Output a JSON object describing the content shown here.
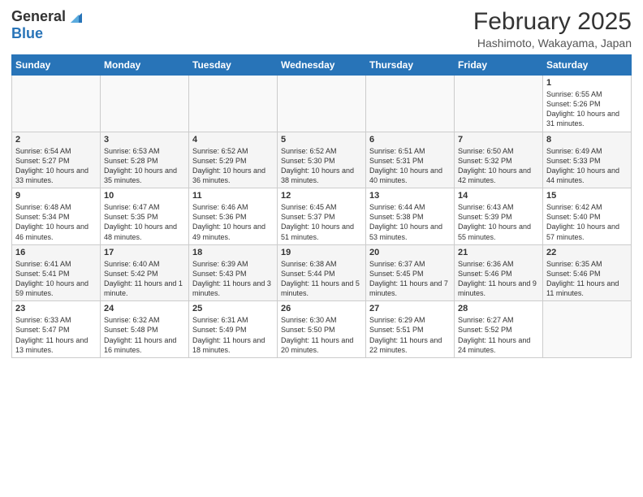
{
  "header": {
    "logo_general": "General",
    "logo_blue": "Blue",
    "month_title": "February 2025",
    "location": "Hashimoto, Wakayama, Japan"
  },
  "weekdays": [
    "Sunday",
    "Monday",
    "Tuesday",
    "Wednesday",
    "Thursday",
    "Friday",
    "Saturday"
  ],
  "weeks": [
    [
      {
        "day": "",
        "info": ""
      },
      {
        "day": "",
        "info": ""
      },
      {
        "day": "",
        "info": ""
      },
      {
        "day": "",
        "info": ""
      },
      {
        "day": "",
        "info": ""
      },
      {
        "day": "",
        "info": ""
      },
      {
        "day": "1",
        "info": "Sunrise: 6:55 AM\nSunset: 5:26 PM\nDaylight: 10 hours and 31 minutes."
      }
    ],
    [
      {
        "day": "2",
        "info": "Sunrise: 6:54 AM\nSunset: 5:27 PM\nDaylight: 10 hours and 33 minutes."
      },
      {
        "day": "3",
        "info": "Sunrise: 6:53 AM\nSunset: 5:28 PM\nDaylight: 10 hours and 35 minutes."
      },
      {
        "day": "4",
        "info": "Sunrise: 6:52 AM\nSunset: 5:29 PM\nDaylight: 10 hours and 36 minutes."
      },
      {
        "day": "5",
        "info": "Sunrise: 6:52 AM\nSunset: 5:30 PM\nDaylight: 10 hours and 38 minutes."
      },
      {
        "day": "6",
        "info": "Sunrise: 6:51 AM\nSunset: 5:31 PM\nDaylight: 10 hours and 40 minutes."
      },
      {
        "day": "7",
        "info": "Sunrise: 6:50 AM\nSunset: 5:32 PM\nDaylight: 10 hours and 42 minutes."
      },
      {
        "day": "8",
        "info": "Sunrise: 6:49 AM\nSunset: 5:33 PM\nDaylight: 10 hours and 44 minutes."
      }
    ],
    [
      {
        "day": "9",
        "info": "Sunrise: 6:48 AM\nSunset: 5:34 PM\nDaylight: 10 hours and 46 minutes."
      },
      {
        "day": "10",
        "info": "Sunrise: 6:47 AM\nSunset: 5:35 PM\nDaylight: 10 hours and 48 minutes."
      },
      {
        "day": "11",
        "info": "Sunrise: 6:46 AM\nSunset: 5:36 PM\nDaylight: 10 hours and 49 minutes."
      },
      {
        "day": "12",
        "info": "Sunrise: 6:45 AM\nSunset: 5:37 PM\nDaylight: 10 hours and 51 minutes."
      },
      {
        "day": "13",
        "info": "Sunrise: 6:44 AM\nSunset: 5:38 PM\nDaylight: 10 hours and 53 minutes."
      },
      {
        "day": "14",
        "info": "Sunrise: 6:43 AM\nSunset: 5:39 PM\nDaylight: 10 hours and 55 minutes."
      },
      {
        "day": "15",
        "info": "Sunrise: 6:42 AM\nSunset: 5:40 PM\nDaylight: 10 hours and 57 minutes."
      }
    ],
    [
      {
        "day": "16",
        "info": "Sunrise: 6:41 AM\nSunset: 5:41 PM\nDaylight: 10 hours and 59 minutes."
      },
      {
        "day": "17",
        "info": "Sunrise: 6:40 AM\nSunset: 5:42 PM\nDaylight: 11 hours and 1 minute."
      },
      {
        "day": "18",
        "info": "Sunrise: 6:39 AM\nSunset: 5:43 PM\nDaylight: 11 hours and 3 minutes."
      },
      {
        "day": "19",
        "info": "Sunrise: 6:38 AM\nSunset: 5:44 PM\nDaylight: 11 hours and 5 minutes."
      },
      {
        "day": "20",
        "info": "Sunrise: 6:37 AM\nSunset: 5:45 PM\nDaylight: 11 hours and 7 minutes."
      },
      {
        "day": "21",
        "info": "Sunrise: 6:36 AM\nSunset: 5:46 PM\nDaylight: 11 hours and 9 minutes."
      },
      {
        "day": "22",
        "info": "Sunrise: 6:35 AM\nSunset: 5:46 PM\nDaylight: 11 hours and 11 minutes."
      }
    ],
    [
      {
        "day": "23",
        "info": "Sunrise: 6:33 AM\nSunset: 5:47 PM\nDaylight: 11 hours and 13 minutes."
      },
      {
        "day": "24",
        "info": "Sunrise: 6:32 AM\nSunset: 5:48 PM\nDaylight: 11 hours and 16 minutes."
      },
      {
        "day": "25",
        "info": "Sunrise: 6:31 AM\nSunset: 5:49 PM\nDaylight: 11 hours and 18 minutes."
      },
      {
        "day": "26",
        "info": "Sunrise: 6:30 AM\nSunset: 5:50 PM\nDaylight: 11 hours and 20 minutes."
      },
      {
        "day": "27",
        "info": "Sunrise: 6:29 AM\nSunset: 5:51 PM\nDaylight: 11 hours and 22 minutes."
      },
      {
        "day": "28",
        "info": "Sunrise: 6:27 AM\nSunset: 5:52 PM\nDaylight: 11 hours and 24 minutes."
      },
      {
        "day": "",
        "info": ""
      }
    ]
  ]
}
